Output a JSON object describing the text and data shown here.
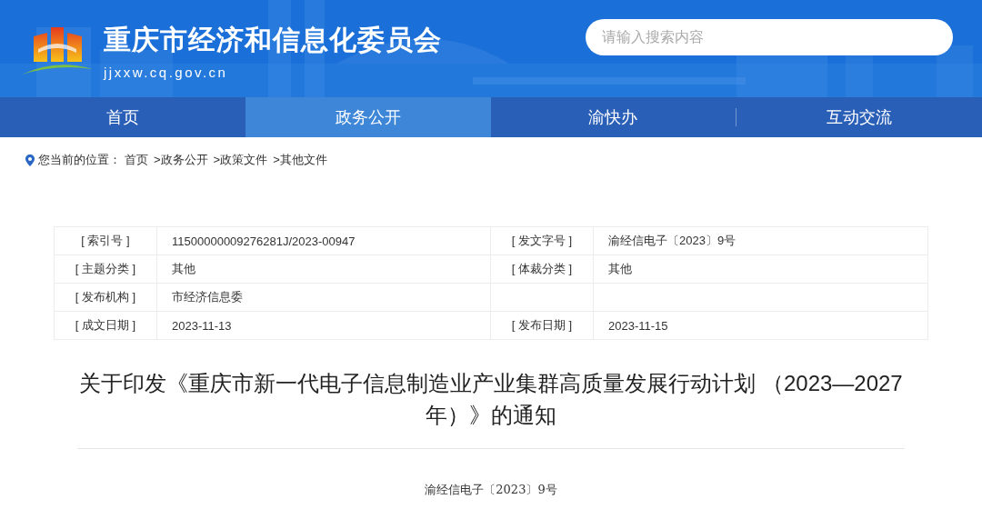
{
  "header": {
    "site_name": "重庆市经济和信息化委员会",
    "domain": "jjxxw.cq.gov.cn",
    "search": {
      "placeholder": "请输入搜索内容"
    }
  },
  "nav": [
    {
      "label": "首页",
      "selected": false
    },
    {
      "label": "政务公开",
      "selected": true
    },
    {
      "label": "渝快办",
      "selected": false
    },
    {
      "label": "互动交流",
      "selected": false
    }
  ],
  "breadcrumb": {
    "label": "您当前的位置：",
    "items": [
      "首页",
      ">政务公开",
      ">政策文件",
      ">其他文件"
    ]
  },
  "info_table": {
    "rows": [
      [
        {
          "label": "[ 索引号 ]",
          "value": "11500000009276281J/2023-00947"
        },
        {
          "label": "[ 发文字号 ]",
          "value": "渝经信电子〔2023〕9号"
        }
      ],
      [
        {
          "label": "[ 主题分类 ]",
          "value": "其他"
        },
        {
          "label": "[ 体裁分类 ]",
          "value": "其他"
        }
      ],
      [
        {
          "label": "[ 发布机构 ]",
          "value": "市经济信息委"
        }
      ],
      [
        {
          "label": "[ 成文日期 ]",
          "value": "2023-11-13"
        },
        {
          "label": "[ 发布日期 ]",
          "value": "2023-11-15"
        }
      ]
    ]
  },
  "article": {
    "title": "关于印发《重庆市新一代电子信息制造业产业集群高质量发展行动计划 （2023—2027年）》的通知",
    "doc_number": "渝经信电子〔2023〕9号"
  }
}
